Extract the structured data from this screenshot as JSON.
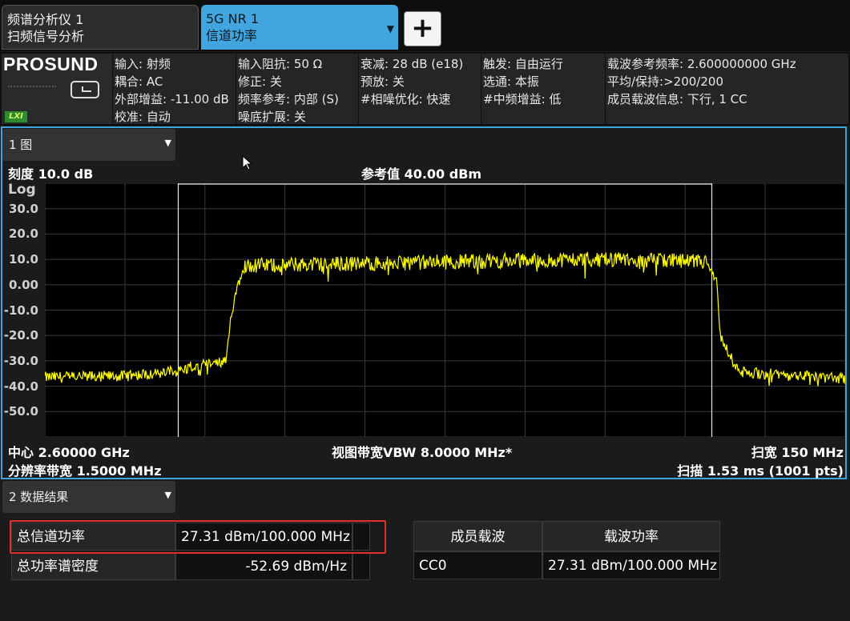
{
  "tabs": [
    {
      "line1": "频谱分析仪 1",
      "line2": "扫频信号分析"
    },
    {
      "line1": "5G NR 1",
      "line2": "信道功率"
    }
  ],
  "add_tab_label": "+",
  "brand": "PROSUND",
  "lxi": "LXI",
  "settings": [
    [
      "输入: 射频",
      "耦合: AC",
      "外部增益: -11.00 dB",
      "校准: 自动"
    ],
    [
      "输入阻抗: 50 Ω",
      "修正: 关",
      "频率参考: 内部 (S)",
      "噪底扩展: 关"
    ],
    [
      "衰减: 28 dB (e18)",
      "预放: 关",
      "#相噪优化: 快速"
    ],
    [
      "触发: 自由运行",
      "选通: 本振",
      "#中频增益: 低"
    ],
    [
      "载波参考频率: 2.600000000 GHz",
      "平均/保持:>200/200",
      "成员载波信息: 下行, 1 CC"
    ]
  ],
  "window1": {
    "selector": "1 图",
    "scale": "刻度 10.0 dB",
    "ref_value": "参考值 40.00 dBm",
    "log_label": "Log",
    "center": "中心 2.60000 GHz",
    "vbw": "视图带宽VBW 8.0000 MHz*",
    "span": "扫宽 150 MHz",
    "rbw": "分辨率带宽 1.5000 MHz",
    "sweep": "扫描 1.53 ms (1001 pts)"
  },
  "chart_data": {
    "type": "line",
    "title": "",
    "xlabel": "",
    "ylabel": "",
    "y_ticks": [
      "30.0",
      "20.0",
      "10.0",
      "0.00",
      "-10.0",
      "-20.0",
      "-30.0",
      "-40.0",
      "-50.0"
    ],
    "ylim": [
      -60,
      40
    ],
    "x_range_mhz": [
      2525,
      2675
    ],
    "points_count": 1001,
    "grid": true,
    "trace_color": "#ffff00",
    "series": [
      {
        "x": [
          2525,
          2540,
          2550,
          2555,
          2559,
          2560,
          2562,
          2575,
          2600,
          2625,
          2640,
          2649,
          2651,
          2651.5,
          2655,
          2665,
          2675
        ],
        "values": [
          -36.5,
          -36.0,
          -34.0,
          -31.5,
          -30.5,
          -10.0,
          7.5,
          8.0,
          9.0,
          10.0,
          9.5,
          9.0,
          0.0,
          -20.0,
          -34.5,
          -35.5,
          -37.0
        ]
      }
    ],
    "channel_bw_markers_mhz": [
      2550,
      2650
    ]
  },
  "window2": {
    "selector": "2 数据结果",
    "rows": [
      {
        "label": "总信道功率",
        "value": "27.31 dBm/100.000 MHz"
      },
      {
        "label": "总功率谱密度",
        "value": "-52.69 dBm/Hz"
      }
    ],
    "carrier_table": {
      "headers": [
        "成员载波",
        "载波功率"
      ],
      "rows": [
        [
          "CC0",
          "27.31 dBm/100.000 MHz"
        ]
      ]
    }
  }
}
